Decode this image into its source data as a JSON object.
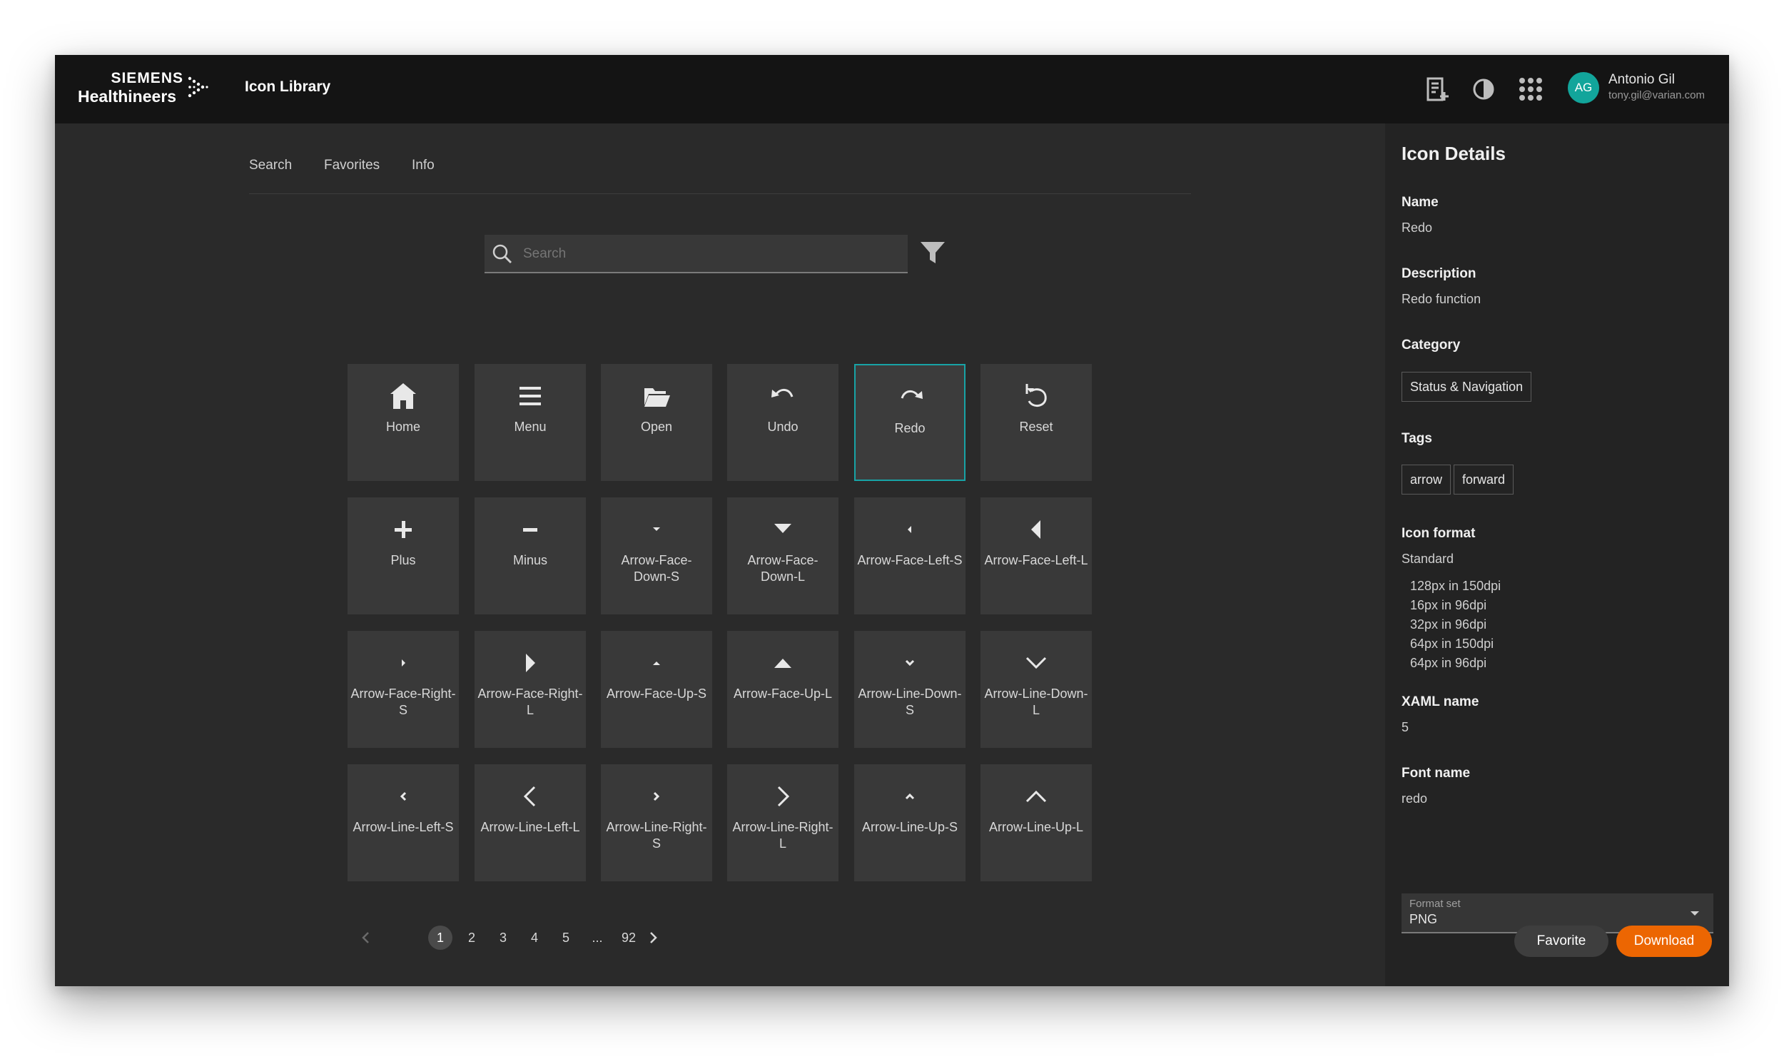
{
  "header": {
    "brand_line1": "SIEMENS",
    "brand_line2": "Healthineers",
    "app_title": "Icon Library",
    "user": {
      "initials": "AG",
      "name": "Antonio Gil",
      "email": "tony.gil@varian.com"
    }
  },
  "tabs": [
    "Search",
    "Favorites",
    "Info"
  ],
  "search": {
    "placeholder": "Search"
  },
  "icons": [
    {
      "label": "Home",
      "icon": "home-icon"
    },
    {
      "label": "Menu",
      "icon": "menu-icon"
    },
    {
      "label": "Open",
      "icon": "folder-open-icon"
    },
    {
      "label": "Undo",
      "icon": "undo-icon"
    },
    {
      "label": "Redo",
      "icon": "redo-icon"
    },
    {
      "label": "Reset",
      "icon": "reset-icon"
    },
    {
      "label": "Plus",
      "icon": "plus-icon"
    },
    {
      "label": "Minus",
      "icon": "minus-icon"
    },
    {
      "label": "Arrow-Face-Down-S",
      "icon": "arrow-face-down-s-icon"
    },
    {
      "label": "Arrow-Face-Down-L",
      "icon": "arrow-face-down-l-icon"
    },
    {
      "label": "Arrow-Face-Left-S",
      "icon": "arrow-face-left-s-icon"
    },
    {
      "label": "Arrow-Face-Left-L",
      "icon": "arrow-face-left-l-icon"
    },
    {
      "label": "Arrow-Face-Right-S",
      "icon": "arrow-face-right-s-icon"
    },
    {
      "label": "Arrow-Face-Right-L",
      "icon": "arrow-face-right-l-icon"
    },
    {
      "label": "Arrow-Face-Up-S",
      "icon": "arrow-face-up-s-icon"
    },
    {
      "label": "Arrow-Face-Up-L",
      "icon": "arrow-face-up-l-icon"
    },
    {
      "label": "Arrow-Line-Down-S",
      "icon": "arrow-line-down-s-icon"
    },
    {
      "label": "Arrow-Line-Down-L",
      "icon": "arrow-line-down-l-icon"
    },
    {
      "label": "Arrow-Line-Left-S",
      "icon": "arrow-line-left-s-icon"
    },
    {
      "label": "Arrow-Line-Left-L",
      "icon": "arrow-line-left-l-icon"
    },
    {
      "label": "Arrow-Line-Right-S",
      "icon": "arrow-line-right-s-icon"
    },
    {
      "label": "Arrow-Line-Right-L",
      "icon": "arrow-line-right-l-icon"
    },
    {
      "label": "Arrow-Line-Up-S",
      "icon": "arrow-line-up-s-icon"
    },
    {
      "label": "Arrow-Line-Up-L",
      "icon": "arrow-line-up-l-icon"
    }
  ],
  "selected_icon": "Redo",
  "pagination": {
    "pages": [
      "1",
      "2",
      "3",
      "4",
      "5",
      "...",
      "92"
    ],
    "current": "1"
  },
  "details": {
    "title": "Icon Details",
    "name_label": "Name",
    "name_value": "Redo",
    "description_label": "Description",
    "description_value": "Redo function",
    "category_label": "Category",
    "category_value": "Status & Navigation",
    "tags_label": "Tags",
    "tags": [
      "arrow",
      "forward"
    ],
    "format_label": "Icon format",
    "format_value": "Standard",
    "format_sizes": [
      "128px in 150dpi",
      "16px in 96dpi",
      "32px in 96dpi",
      "64px in 150dpi",
      "64px in 96dpi"
    ],
    "xaml_label": "XAML name",
    "xaml_value": "5",
    "font_label": "Font name",
    "font_value": "redo",
    "format_set_label": "Format set",
    "format_set_value": "PNG",
    "favorite_label": "Favorite",
    "download_label": "Download"
  },
  "colors": {
    "accent": "#18a3a6",
    "download": "#ec6602",
    "avatar": "#12a59b"
  }
}
